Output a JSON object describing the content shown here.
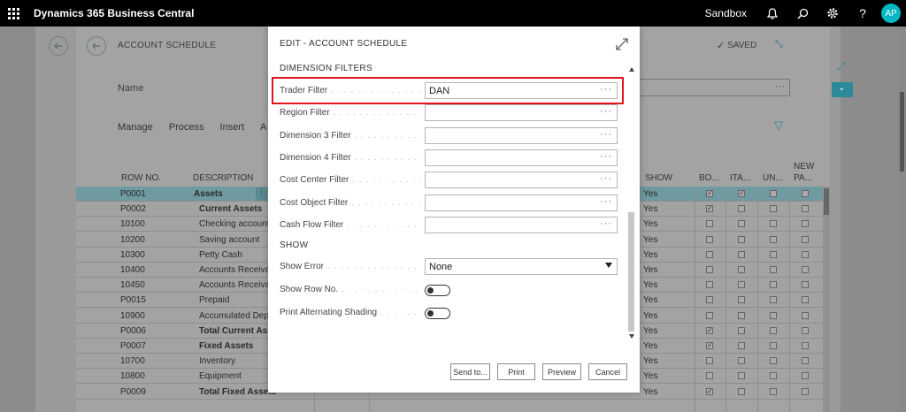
{
  "topbar": {
    "app_title": "Dynamics 365 Business Central",
    "environment": "Sandbox",
    "avatar_initials": "AP",
    "icons": [
      "waffle-icon",
      "bell-icon",
      "search-icon",
      "gear-icon",
      "help-icon"
    ]
  },
  "background_page": {
    "title": "ACCOUNT SCHEDULE",
    "saved_label": "SAVED",
    "name_label": "Name",
    "menu": [
      "Manage",
      "Process",
      "Insert",
      "A"
    ],
    "columns": {
      "row_no": "ROW NO.",
      "description": "DESCRIPTION",
      "show": "SHOW",
      "bold": "BO...",
      "italic": "ITA...",
      "underline": "UN...",
      "new_page_1": "NEW",
      "new_page_2": "PA..."
    },
    "rows": [
      {
        "row_no": "P0001",
        "description": "Assets",
        "bold": true,
        "show": "Yes",
        "b": true,
        "i": true,
        "u": false,
        "np": false,
        "selected": true
      },
      {
        "row_no": "P0002",
        "description": "Current Assets",
        "bold": true,
        "show": "Yes",
        "b": true,
        "i": false,
        "u": false,
        "np": false
      },
      {
        "row_no": "10100",
        "description": "Checking account",
        "bold": false,
        "show": "Yes",
        "b": false,
        "i": false,
        "u": false,
        "np": false
      },
      {
        "row_no": "10200",
        "description": "Saving account",
        "bold": false,
        "show": "Yes",
        "b": false,
        "i": false,
        "u": false,
        "np": false
      },
      {
        "row_no": "10300",
        "description": "Petty Cash",
        "bold": false,
        "show": "Yes",
        "b": false,
        "i": false,
        "u": false,
        "np": false
      },
      {
        "row_no": "10400",
        "description": "Accounts Receivab",
        "bold": false,
        "show": "Yes",
        "b": false,
        "i": false,
        "u": false,
        "np": false
      },
      {
        "row_no": "10450",
        "description": "Accounts Receivab",
        "bold": false,
        "show": "Yes",
        "b": false,
        "i": false,
        "u": false,
        "np": false
      },
      {
        "row_no": "P0015",
        "description": "Prepaid",
        "bold": false,
        "show": "Yes",
        "b": false,
        "i": false,
        "u": false,
        "np": false
      },
      {
        "row_no": "10900",
        "description": "Accumulated Depr",
        "bold": false,
        "show": "Yes",
        "b": false,
        "i": false,
        "u": false,
        "np": false
      },
      {
        "row_no": "P0006",
        "description": "Total Current Ass",
        "bold": true,
        "show": "Yes",
        "b": true,
        "i": false,
        "u": false,
        "np": false
      },
      {
        "row_no": "P0007",
        "description": "Fixed Assets",
        "bold": true,
        "show": "Yes",
        "b": true,
        "i": false,
        "u": false,
        "np": false
      },
      {
        "row_no": "10700",
        "description": "Inventory",
        "bold": false,
        "show": "Yes",
        "b": false,
        "i": false,
        "u": false,
        "np": false
      },
      {
        "row_no": "10800",
        "description": "Equipment",
        "bold": false,
        "show": "Yes",
        "b": false,
        "i": false,
        "u": false,
        "np": false
      },
      {
        "row_no": "P0009",
        "description": "Total Fixed Assets",
        "bold": true,
        "show": "Yes",
        "b": true,
        "i": false,
        "u": false,
        "np": false
      }
    ]
  },
  "modal": {
    "title": "EDIT - ACCOUNT SCHEDULE",
    "dimension_section": "DIMENSION FILTERS",
    "fields": [
      {
        "label": "Trader Filter",
        "value": "DAN"
      },
      {
        "label": "Region Filter",
        "value": ""
      },
      {
        "label": "Dimension 3 Filter",
        "value": ""
      },
      {
        "label": "Dimension 4 Filter",
        "value": ""
      },
      {
        "label": "Cost Center Filter",
        "value": ""
      },
      {
        "label": "Cost Object Filter",
        "value": ""
      },
      {
        "label": "Cash Flow Filter",
        "value": ""
      }
    ],
    "show_section": "SHOW",
    "show_error_label": "Show Error",
    "show_error_value": "None",
    "show_row_no_label": "Show Row No.",
    "show_row_no_value": false,
    "print_shading_label": "Print Alternating Shading",
    "print_shading_value": false,
    "ellipsis": "···",
    "buttons": {
      "send_to": "Send to...",
      "print": "Print",
      "preview": "Preview",
      "cancel": "Cancel"
    }
  },
  "colors": {
    "highlight": "#e1161d",
    "selected_row": "#6f9aa0",
    "avatar": "#00b7c3"
  }
}
